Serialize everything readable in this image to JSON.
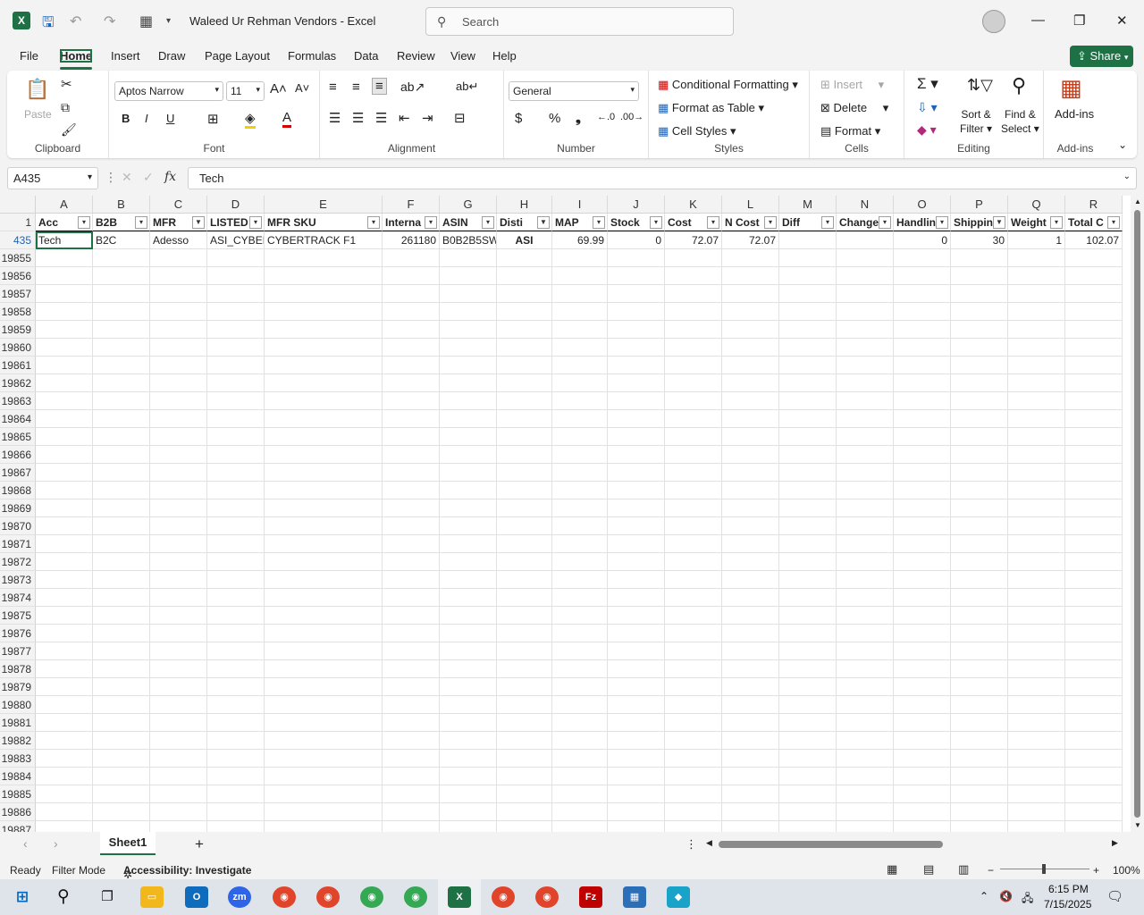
{
  "window": {
    "title": "Waleed Ur Rehman Vendors  -  Excel",
    "search_placeholder": "Search",
    "minimize": "—",
    "maximize": "❐",
    "close": "✕"
  },
  "menu": [
    "File",
    "Home",
    "Insert",
    "Draw",
    "Page Layout",
    "Formulas",
    "Data",
    "Review",
    "View",
    "Help"
  ],
  "share_label": "Share",
  "ribbon": {
    "clipboard": {
      "label": "Clipboard",
      "paste": "Paste"
    },
    "font": {
      "label": "Font",
      "name": "Aptos Narrow",
      "size": "11",
      "bold": "B",
      "italic": "I",
      "underline": "U"
    },
    "alignment": {
      "label": "Alignment"
    },
    "number": {
      "label": "Number",
      "format": "General",
      "currency": "$",
      "percent": "%",
      "comma": "❟"
    },
    "styles": {
      "label": "Styles",
      "conditional": "Conditional Formatting",
      "table": "Format as Table",
      "cell_styles": "Cell Styles"
    },
    "cells": {
      "label": "Cells",
      "insert": "Insert",
      "delete": "Delete",
      "format": "Format"
    },
    "editing": {
      "label": "Editing",
      "sort1": "Sort &",
      "sort2": "Filter",
      "find1": "Find &",
      "find2": "Select"
    },
    "addins": {
      "label": "Add-ins",
      "btn": "Add-ins"
    }
  },
  "formula_bar": {
    "name_box": "A435",
    "content": "Tech"
  },
  "columns": [
    "A",
    "B",
    "C",
    "D",
    "E",
    "F",
    "G",
    "H",
    "I",
    "J",
    "K",
    "L",
    "M",
    "N",
    "O",
    "P",
    "Q",
    "R"
  ],
  "headers": [
    "Acc",
    "B2B",
    "MFR",
    "LISTED",
    "MFR SKU",
    "Interna",
    "ASIN",
    "Disti",
    "MAP",
    "Stock",
    "Cost",
    "N Cost",
    "Diff",
    "Change",
    "Handlin",
    "Shippin",
    "Weight",
    "Total C"
  ],
  "filtered_columns": [
    2,
    7,
    15
  ],
  "data_row": {
    "row": "435",
    "cells": [
      "Tech",
      "B2C",
      "Adesso",
      "ASI_CYBER",
      "CYBERTRACK F1",
      "261180",
      "B0B2B5SW",
      "ASI",
      "69.99",
      "0",
      "72.07",
      "72.07",
      "",
      "",
      "0",
      "30",
      "1",
      "102.07"
    ]
  },
  "row_numbers": [
    "1",
    "435",
    "19855",
    "19856",
    "19857",
    "19858",
    "19859",
    "19860",
    "19861",
    "19862",
    "19863",
    "19864",
    "19865",
    "19866",
    "19867",
    "19868",
    "19869",
    "19870",
    "19871",
    "19872",
    "19873",
    "19874",
    "19875",
    "19876",
    "19877",
    "19878",
    "19879",
    "19880",
    "19881",
    "19882",
    "19883",
    "19884",
    "19885",
    "19886",
    "19887"
  ],
  "sheet_tab": "Sheet1",
  "status": {
    "ready": "Ready",
    "mode": "Filter Mode",
    "accessibility": "Accessibility: Investigate",
    "zoom": "100%"
  },
  "taskbar": {
    "time": "6:15 PM",
    "date": "7/15/2025"
  }
}
